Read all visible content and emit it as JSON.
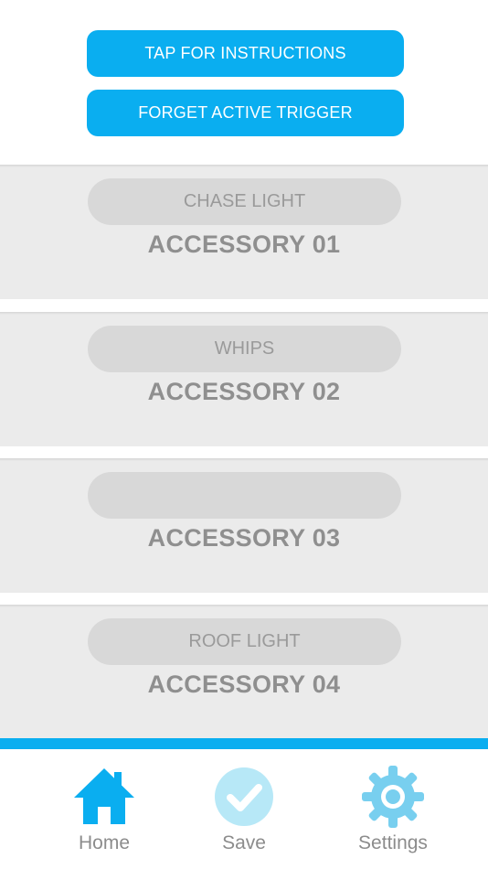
{
  "colors": {
    "accent": "#0aaef0",
    "card_background": "#ebebeb",
    "pill_background": "#d8d8d8",
    "muted_text": "#8f8f8f",
    "save_icon": "#b7e8f7",
    "settings_icon": "#78cfef"
  },
  "actions": {
    "instructions_label": "TAP FOR INSTRUCTIONS",
    "forget_label": "FORGET ACTIVE TRIGGER"
  },
  "accessories": [
    {
      "trigger": "CHASE LIGHT",
      "title": "ACCESSORY 01"
    },
    {
      "trigger": "WHIPS",
      "title": "ACCESSORY 02"
    },
    {
      "trigger": "",
      "title": "ACCESSORY 03"
    },
    {
      "trigger": "ROOF LIGHT",
      "title": "ACCESSORY 04"
    }
  ],
  "tabbar": {
    "items": [
      {
        "label": "Home",
        "icon": "home-icon",
        "active": true
      },
      {
        "label": "Save",
        "icon": "checkmark-circle-icon",
        "active": false
      },
      {
        "label": "Settings",
        "icon": "gear-icon",
        "active": false
      }
    ]
  }
}
